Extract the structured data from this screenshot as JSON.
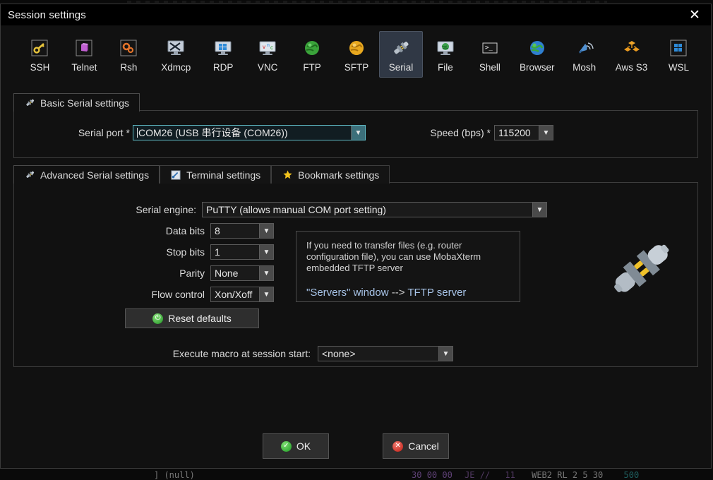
{
  "window": {
    "title": "Session settings",
    "close_icon": "close-icon"
  },
  "toolbar": {
    "items": [
      {
        "label": "SSH",
        "icon": "key-icon"
      },
      {
        "label": "Telnet",
        "icon": "telnet-icon"
      },
      {
        "label": "Rsh",
        "icon": "rsh-gears-icon"
      },
      {
        "label": "Xdmcp",
        "icon": "xdmcp-monitor-icon"
      },
      {
        "label": "RDP",
        "icon": "rdp-monitor-icon"
      },
      {
        "label": "VNC",
        "icon": "vnc-monitor-icon"
      },
      {
        "label": "FTP",
        "icon": "ftp-globe-icon"
      },
      {
        "label": "SFTP",
        "icon": "sftp-globe-icon"
      },
      {
        "label": "Serial",
        "icon": "serial-plug-icon",
        "selected": true
      },
      {
        "label": "File",
        "icon": "file-monitor-icon"
      },
      {
        "label": "Shell",
        "icon": "shell-console-icon"
      },
      {
        "label": "Browser",
        "icon": "browser-globe-icon"
      },
      {
        "label": "Mosh",
        "icon": "mosh-dish-icon"
      },
      {
        "label": "Aws S3",
        "icon": "aws-s3-icon"
      },
      {
        "label": "WSL",
        "icon": "wsl-windows-icon"
      }
    ]
  },
  "basic": {
    "tab_label": "Basic Serial settings",
    "tab_icon": "serial-plug-icon",
    "serial_port_label": "Serial port *",
    "serial_port_value": "COM26  (USB 串行设备 (COM26))",
    "speed_label": "Speed (bps) *",
    "speed_value": "115200"
  },
  "advanced": {
    "tabs": [
      {
        "label": "Advanced Serial settings",
        "icon": "serial-plug-icon",
        "selected": true
      },
      {
        "label": "Terminal settings",
        "icon": "terminal-icon",
        "selected": false
      },
      {
        "label": "Bookmark settings",
        "icon": "star-icon",
        "selected": false
      }
    ],
    "serial_engine_label": "Serial engine:",
    "serial_engine_value": "PuTTY   (allows manual COM port setting)",
    "data_bits_label": "Data bits",
    "data_bits_value": "8",
    "stop_bits_label": "Stop bits",
    "stop_bits_value": "1",
    "parity_label": "Parity",
    "parity_value": "None",
    "flow_control_label": "Flow control",
    "flow_control_value": "Xon/Xoff",
    "reset_defaults_label": "Reset defaults",
    "reset_icon": "reset-power-icon",
    "macro_label": "Execute macro at session start:",
    "macro_value": "<none>",
    "info_text": "If you need to transfer files (e.g. router configuration file), you can use MobaXterm embedded TFTP server",
    "info_link_prefix": "\"Servers\" window",
    "info_link_arrow": "-->",
    "info_link_target": "TFTP server",
    "plug_icon": "serial-plug-large-icon"
  },
  "footer": {
    "ok_label": "OK",
    "ok_icon": "check-circle-icon",
    "cancel_label": "Cancel",
    "cancel_icon": "x-circle-icon"
  },
  "background": {
    "bottom_line": "   ] (null)                                          30 00 00  JE //   11   WEB2  RL 2  5 30      500"
  },
  "colors": {
    "accent_selected_tab": "#303845",
    "link_blue": "#a8c4e8",
    "focus_border": "#5fb9c4",
    "ok_green": "#1d9c22",
    "cancel_red": "#c01a10"
  }
}
